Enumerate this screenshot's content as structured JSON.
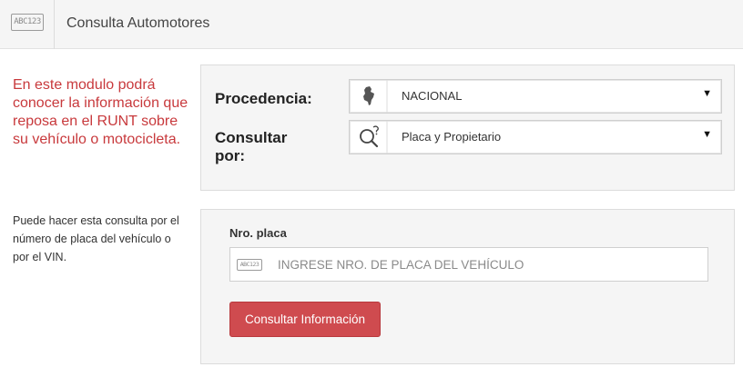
{
  "header": {
    "logo_text": "ABC123",
    "title": "Consulta Automotores"
  },
  "intro": {
    "highlight": "En este modulo podrá conocer la información que reposa en el RUNT sobre su vehículo o motocicleta.",
    "help": "Puede hacer esta consulta por el número de placa del vehículo o por el VIN."
  },
  "form": {
    "procedencia": {
      "label": "Procedencia:",
      "value": "NACIONAL",
      "icon": "colombia-map-icon"
    },
    "consultar": {
      "label": "Consultar por:",
      "value": "Placa y Propietario",
      "icon": "search-question-icon"
    },
    "placa": {
      "label": "Nro. placa",
      "badge_text": "ABC123",
      "placeholder": "INGRESE NRO. DE PLACA DEL VEHÍCULO",
      "value": ""
    },
    "submit_label": "Consultar Información"
  },
  "colors": {
    "accent": "#cf4b4f",
    "intro_text": "#c8393c",
    "panel_bg": "#f5f5f5"
  }
}
